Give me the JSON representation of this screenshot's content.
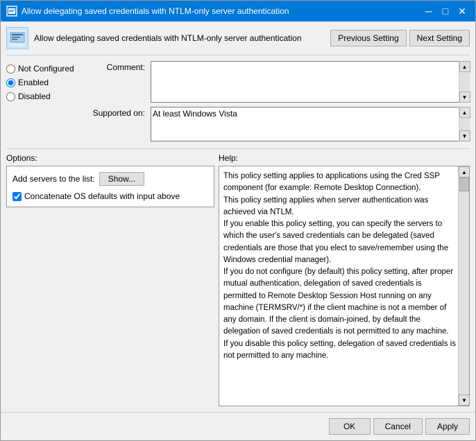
{
  "window": {
    "title": "Allow delegating saved credentials with NTLM-only server authentication",
    "icon": "policy-icon"
  },
  "header": {
    "title": "Allow delegating saved credentials with NTLM-only server authentication",
    "previous_button": "Previous Setting",
    "next_button": "Next Setting"
  },
  "radio_options": {
    "not_configured": "Not Configured",
    "enabled": "Enabled",
    "disabled": "Disabled",
    "selected": "enabled"
  },
  "comment_label": "Comment:",
  "comment_value": "",
  "supported_label": "Supported on:",
  "supported_value": "At least Windows Vista",
  "sections": {
    "options_label": "Options:",
    "help_label": "Help:"
  },
  "options": {
    "add_servers_label": "Add servers to the list:",
    "show_button": "Show...",
    "concat_label": "Concatenate OS defaults with input above",
    "concat_checked": true
  },
  "help_text": {
    "p1": "This policy setting applies to applications using the Cred SSP component (for example: Remote Desktop Connection).",
    "p2": "This policy setting applies when server authentication was achieved via NTLM.",
    "p3": "If you enable this policy setting, you can specify the servers to which the user's saved credentials can be delegated (saved credentials are those that you elect to save/remember using the Windows credential manager).",
    "p4": "If you do not configure (by default) this policy setting, after proper mutual authentication, delegation of saved credentials is permitted to Remote Desktop Session Host running on any machine (TERMSRV/*) if the client machine is not a member of any domain. If the client is domain-joined, by default the delegation of saved credentials is not permitted to any machine.",
    "p5": "If you disable this policy setting, delegation of saved credentials is not permitted to any machine."
  },
  "footer": {
    "ok_label": "OK",
    "cancel_label": "Cancel",
    "apply_label": "Apply"
  },
  "titlebar": {
    "minimize": "─",
    "maximize": "□",
    "close": "✕"
  }
}
